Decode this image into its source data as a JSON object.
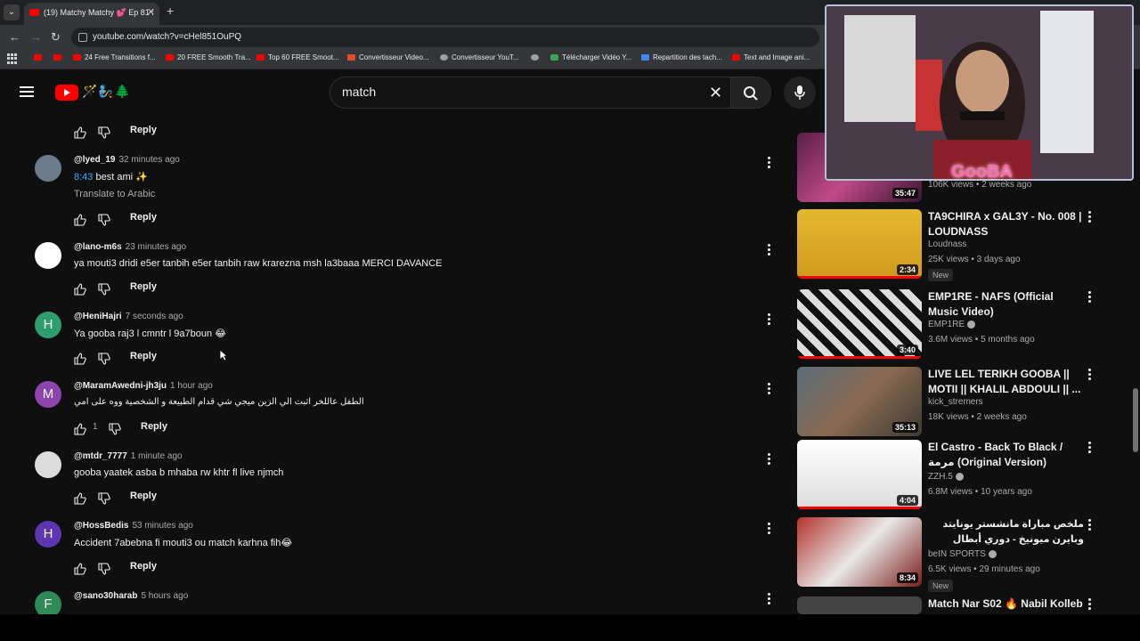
{
  "browser": {
    "tab_title": "(19) Matchy Matchy 💕 Ep 81 :",
    "url": "youtube.com/watch?v=cHel851OuPQ",
    "bookmarks": [
      "24 Free Transitions f...",
      "20 FREE Smooth Tra...",
      "Top 60 FREE Smoot...",
      "Convertisseur Video...",
      "Convertisseur YouT...",
      "Télécharger Vidéo Y...",
      "Repartition des tach...",
      "Text and Image ani..."
    ]
  },
  "header": {
    "search_value": "match"
  },
  "comments": [
    {
      "author": "@lyed_19",
      "time": "32 minutes ago",
      "timestamp": "8:43",
      "text": "best ami ✨",
      "translate": "Translate to Arabic",
      "avatar_letter": "",
      "avatar_color": "#6b7b8c",
      "reply": "Reply"
    },
    {
      "author": "@lano-m6s",
      "time": "23 minutes ago",
      "text": "ya mouti3 dridi e5er tanbih e5er tanbih raw krarezna msh la3baaa MERCI DAVANCE",
      "avatar_letter": "",
      "avatar_color": "#ffffff",
      "reply": "Reply"
    },
    {
      "author": "@HeniHajri",
      "time": "7 seconds ago",
      "text": "Ya gooba raj3 l cmntr l 9a7boun 😂",
      "avatar_letter": "H",
      "avatar_color": "#2e9e6e",
      "reply": "Reply"
    },
    {
      "author": "@MaramAwedni-jh3ju",
      "time": "1 hour ago",
      "text": "الطفل عاللخر اثبت الي الزين ميجي شي قدام الطبيعة و الشخصية ووه على امي",
      "avatar_letter": "M",
      "avatar_color": "#8e44ad",
      "likes": "1",
      "reply": "Reply"
    },
    {
      "author": "@mtdr_7777",
      "time": "1 minute ago",
      "text": "gooba yaatek asba b mhaba rw khtr fl live njmch",
      "avatar_letter": "",
      "avatar_color": "#dcdcdc",
      "reply": "Reply"
    },
    {
      "author": "@HossBedis",
      "time": "53 minutes ago",
      "text": "Accident 7abebna fi mouti3 ou match karhna fih😂",
      "avatar_letter": "H",
      "avatar_color": "#5e35b1",
      "reply": "Reply"
    },
    {
      "author": "@sano30harab",
      "time": "5 hours ago",
      "avatar_letter": "F",
      "avatar_color": "#2e8b57"
    }
  ],
  "top_reply": "Reply",
  "recommendations": [
    {
      "meta": "106K views • 2 weeks ago",
      "duration": "35:47",
      "thumb_color": "#8a2f6a"
    },
    {
      "title": "TA9CHIRA x GAL3Y - No. 008 | LOUDNASS",
      "channel": "Loudnass",
      "meta": "25K views • 3 days ago",
      "badge": "New",
      "duration": "2:34",
      "thumb_color": "#c9a227"
    },
    {
      "title": "EMP1RE - NAFS (Official Music Video)",
      "channel": "EMP1RE",
      "meta": "3.6M views • 5 months ago",
      "duration": "3:40",
      "thumb_color": "#3a3a3a"
    },
    {
      "title": "LIVE LEL TERIKH GOOBA || MOTII || KHALIL ABDOULI || ...",
      "channel": "kick_stremers",
      "meta": "18K views • 2 weeks ago",
      "duration": "35:13",
      "thumb_color": "#6b5a4a"
    },
    {
      "title": "El Castro - Back To Black / مرمة (Original Version)",
      "channel": "ZZH.5",
      "meta": "6.8M views • 10 years ago",
      "duration": "4:04",
      "thumb_color": "#e8e8e8"
    },
    {
      "title": "ملخص مباراة مانشستر يونايتد وبايرن ميونيخ - دوري أبطال أوروبا للسيدات - ذهاب الدور ...",
      "channel": "beIN SPORTS",
      "meta": "6.5K views • 29 minutes ago",
      "badge": "New",
      "duration": "8:34",
      "thumb_color": "#a8322d"
    },
    {
      "title": "Match Nar S02 🔥 Nabil Kolleb",
      "thumb_color": "#444"
    }
  ],
  "webcam_text": "GooBA"
}
